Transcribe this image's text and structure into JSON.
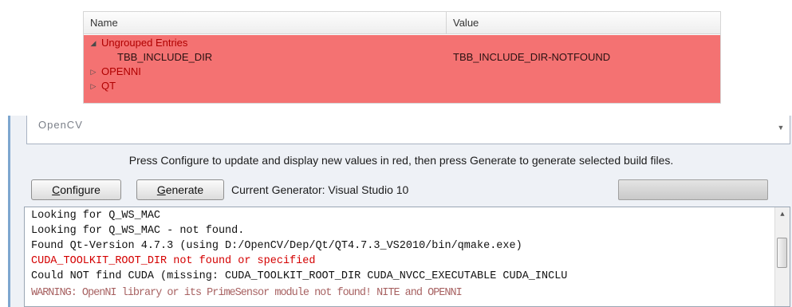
{
  "tree": {
    "columns": {
      "name": "Name",
      "value": "Value"
    },
    "rows": [
      {
        "expander": "◢",
        "label": "Ungrouped Entries",
        "value": "",
        "level": 0
      },
      {
        "expander": "",
        "label": "TBB_INCLUDE_DIR",
        "value": "TBB_INCLUDE_DIR-NOTFOUND",
        "level": 1
      },
      {
        "expander": "▷",
        "label": "OPENNI",
        "value": "",
        "level": 0
      },
      {
        "expander": "▷",
        "label": "QT",
        "value": "",
        "level": 0
      }
    ],
    "highlight_color": "#f47272"
  },
  "cache_list": {
    "visible_text": "OpenCV",
    "scroll_icon": "chevron-down-icon"
  },
  "info_text": "Press Configure to update and display new values in red, then press Generate to generate selected build files.",
  "buttons": {
    "configure": {
      "accel": "C",
      "rest": "onfigure"
    },
    "generate": {
      "accel": "G",
      "rest": "enerate"
    }
  },
  "generator_label": "Current Generator: Visual Studio 10",
  "progress_value": 0,
  "output": {
    "lines": [
      {
        "text": "Looking for Q_WS_MAC",
        "style": "normal"
      },
      {
        "text": "Looking for Q_WS_MAC - not found.",
        "style": "normal"
      },
      {
        "text": "Found Qt-Version 4.7.3 (using D:/OpenCV/Dep/Qt/QT4.7.3_VS2010/bin/qmake.exe)",
        "style": "normal"
      },
      {
        "text": "CUDA_TOOLKIT_ROOT_DIR not found or specified",
        "style": "red"
      },
      {
        "text": "Could NOT find CUDA (missing:  CUDA_TOOLKIT_ROOT_DIR CUDA_NVCC_EXECUTABLE CUDA_INCLU",
        "style": "normal"
      },
      {
        "text": "WARNING: OpenNI library or its PrimeSensor module not found! NITE and OPENNI",
        "style": "garbled"
      }
    ],
    "error_color": "#d40000"
  }
}
